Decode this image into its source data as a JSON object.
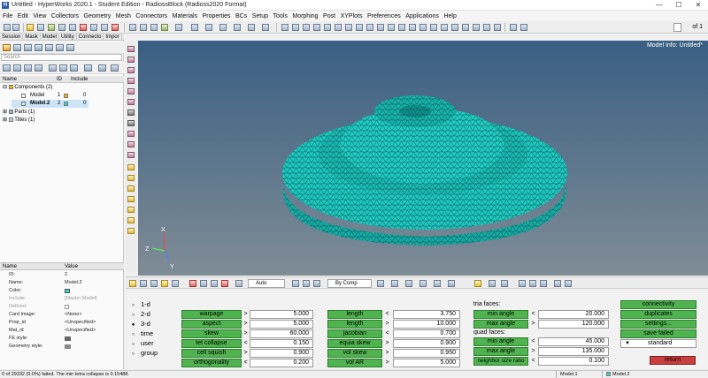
{
  "window": {
    "title": "Untitled - HyperWorks 2020.1 - Student Edition - RadiossBlock (Radioss2020 Format)",
    "controls": [
      "—",
      "☐",
      "✕"
    ]
  },
  "menu": [
    "File",
    "Edit",
    "View",
    "Collectors",
    "Geometry",
    "Mesh",
    "Connectors",
    "Materials",
    "Properties",
    "BCs",
    "Setup",
    "Tools",
    "Morphing",
    "Post",
    "XYPlots",
    "Preferences",
    "Applications",
    "Help"
  ],
  "toolbar": {
    "page_label": "of 1"
  },
  "browser": {
    "tabs": [
      "Session",
      "Mask",
      "Model",
      "Utility",
      "Connecto",
      "Impor"
    ],
    "search_placeholder": "Search",
    "columns": {
      "name": "Name",
      "id": "ID",
      "color": "",
      "include": "Include"
    },
    "components_group": "Components (2)",
    "components": [
      {
        "name": "Model",
        "id": "1",
        "include": "0",
        "color": "#f2b705"
      },
      {
        "name": "Model.2",
        "id": "2",
        "include": "0",
        "color": "#2dd4d4"
      }
    ],
    "parts_group": "Parts (1)",
    "titles_group": "Titles (1)"
  },
  "properties": {
    "col_name": "Name",
    "col_value": "Value",
    "rows": [
      {
        "name": "ID:",
        "value": "2"
      },
      {
        "name": "Name:",
        "value": "Model.2"
      },
      {
        "name": "Color:",
        "value": ""
      },
      {
        "name": "Include:",
        "value": "[Master Model]"
      },
      {
        "name": "Defined:",
        "value": ""
      },
      {
        "name": "Card Image:",
        "value": "<None>"
      },
      {
        "name": "Prop_id",
        "value": "<Unspecified>"
      },
      {
        "name": "Mat_id",
        "value": "<Unspecified>"
      },
      {
        "name": "FE style:",
        "value": ""
      },
      {
        "name": "Geometry style:",
        "value": ""
      }
    ],
    "color_swatch": "#2dd4d4"
  },
  "viewport": {
    "model_info": "Model Info: Untitled*",
    "mesh_color": "#1ec8c0",
    "triad": {
      "x": "X",
      "y": "Y",
      "z": "Z"
    }
  },
  "bottom_toolbar": {
    "auto_select": "Auto",
    "bycomp_select": "By Comp"
  },
  "check_panel": {
    "radios": [
      {
        "symbol": "○",
        "label": "1-d"
      },
      {
        "symbol": "○",
        "label": "2-d"
      },
      {
        "symbol": "●",
        "label": "3-d"
      },
      {
        "symbol": "○",
        "label": "time"
      },
      {
        "symbol": "○",
        "label": "user"
      },
      {
        "symbol": "○",
        "label": "group"
      }
    ],
    "col1": [
      {
        "label": "warpage",
        "op": ">",
        "value": "5.000"
      },
      {
        "label": "aspect",
        "op": ">",
        "value": "5.000"
      },
      {
        "label": "skew",
        "op": ">",
        "value": "60.000"
      },
      {
        "label": "tet collapse",
        "op": "<",
        "value": "0.150"
      },
      {
        "label": "cell squish",
        "op": ">",
        "value": "0.900"
      },
      {
        "label": "orthogonality",
        "op": "<",
        "value": "0.200"
      }
    ],
    "col2": [
      {
        "label": "length",
        "op": "<",
        "value": "3.750"
      },
      {
        "label": "length",
        "op": ">",
        "value": "10.000"
      },
      {
        "label": "jacobian",
        "op": "<",
        "value": "0.700"
      },
      {
        "label": "equia skew",
        "op": ">",
        "value": "0.900"
      },
      {
        "label": "vol skew",
        "op": ">",
        "value": "0.950"
      },
      {
        "label": "vol AR",
        "op": ">",
        "value": "5.000"
      }
    ],
    "tria_label": "tria faces:",
    "tria": [
      {
        "label": "min angle",
        "op": "<",
        "value": "20.000"
      },
      {
        "label": "max angle",
        "op": ">",
        "value": "120.000"
      }
    ],
    "quad_label": "quad faces:",
    "quad": [
      {
        "label": "min angle",
        "op": "<",
        "value": "45.000"
      },
      {
        "label": "max angle",
        "op": ">",
        "value": "135.000"
      },
      {
        "label": "neighbor size ratio",
        "op": "<",
        "value": "0.100"
      }
    ],
    "actions": [
      "connectivity",
      "duplicates",
      "settings...",
      "save failed"
    ],
    "standard": "standard",
    "standard_arrow": "▼",
    "return": "return"
  },
  "status": {
    "message": "0 of 29332 (0.0%) failed.  The min tetra collapse is 0.15488.",
    "cell1": "Model.1",
    "cell2": "Model.2"
  }
}
